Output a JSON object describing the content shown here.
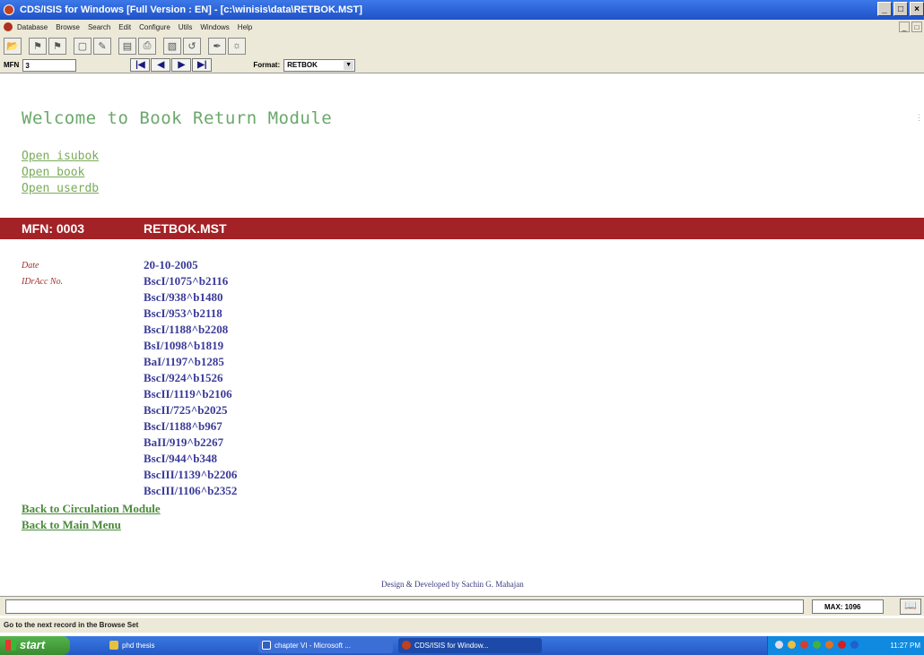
{
  "window": {
    "title": "CDS/ISIS for Windows [Full Version : EN] - [c:\\winisis\\data\\RETBOK.MST]",
    "controls": [
      "_",
      "×"
    ]
  },
  "menu": {
    "items": [
      "Database",
      "Browse",
      "Search",
      "Edit",
      "Configure",
      "Utils",
      "Windows",
      "Help"
    ]
  },
  "navbar": {
    "mfn_label": "MFN",
    "mfn_value": "3",
    "format_label": "Format:",
    "format_value": "RETBOK",
    "buttons": [
      "|◀",
      "◀",
      "▶",
      "▶|"
    ]
  },
  "content": {
    "welcome": "Welcome to Book Return Module",
    "open_links": [
      "Open isubok",
      "Open book",
      "Open userdb"
    ],
    "record_mfn": "MFN: 0003",
    "record_file": "RETBOK.MST",
    "date_label": "Date",
    "date_value": "20-10-2005",
    "id_label": "IDrAcc No.",
    "id_values": [
      "BscI/1075^b2116",
      "BscI/938^b1480",
      "BscI/953^b2118",
      "BscI/1188^b2208",
      "BsI/1098^b1819",
      "BaI/1197^b1285",
      "BscI/924^b1526",
      "BscII/1119^b2106",
      "BscII/725^b2025",
      "BscI/1188^b967",
      "BaII/919^b2267",
      "BscI/944^b348",
      "BscIII/1139^b2206",
      "BscIII/1106^b2352"
    ],
    "back_links": [
      "Back to Circulation Module",
      "Back to Main Menu"
    ],
    "credit": "Design & Developed by Sachin G. Mahajan"
  },
  "status": {
    "max": "MAX: 1096",
    "hint": "Go to the next record in the Browse Set"
  },
  "taskbar": {
    "start": "start",
    "tasks": [
      "phd thesis",
      "chapter VI - Microsoft ...",
      "CDS/ISIS for Window..."
    ],
    "clock": "11:27 PM"
  },
  "colors": {
    "title_bar": "#2a62d8",
    "record_header": "#a32226",
    "link_green": "#7aab5a",
    "value_blue": "#3a3a9a",
    "label_red": "#a33030"
  }
}
